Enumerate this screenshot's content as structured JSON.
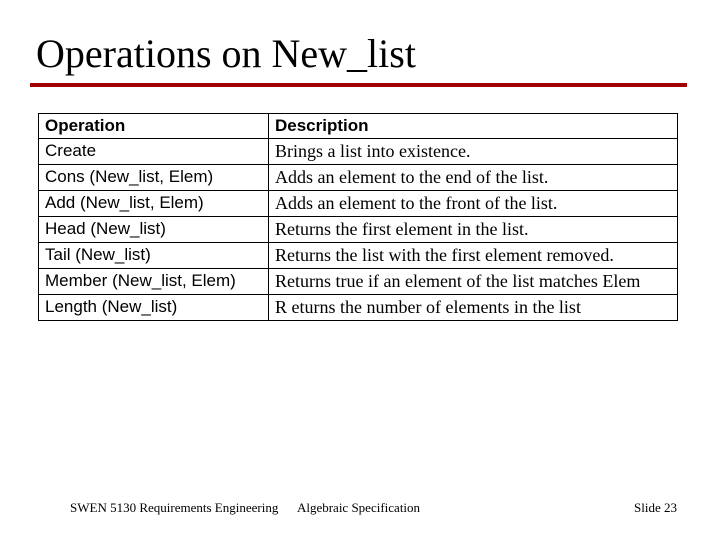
{
  "title": "Operations on New_list",
  "table": {
    "headers": {
      "op": "Operation",
      "desc": "Description"
    },
    "rows": [
      {
        "op": "Create",
        "desc": "Brings a list into existence."
      },
      {
        "op": "Cons (New_list, Elem)",
        "desc": "Adds an element to the end of the list."
      },
      {
        "op": "Add (New_list, Elem)",
        "desc": "Adds an element to the front of the list."
      },
      {
        "op": "Head (New_list)",
        "desc": "Returns the first element in the list."
      },
      {
        "op": "Tail (New_list)",
        "desc": "Returns the list with the        first element removed."
      },
      {
        "op": "Member (New_list, Elem)",
        "desc": "Returns true if an element        of the list matches Elem"
      },
      {
        "op": "Length (New_list)",
        "desc": "R eturns the number of elements in the list"
      }
    ]
  },
  "footer": {
    "course": "SWEN 5130   Requirements Engineering",
    "topic": "Algebraic Specification",
    "slide": "Slide  23"
  }
}
